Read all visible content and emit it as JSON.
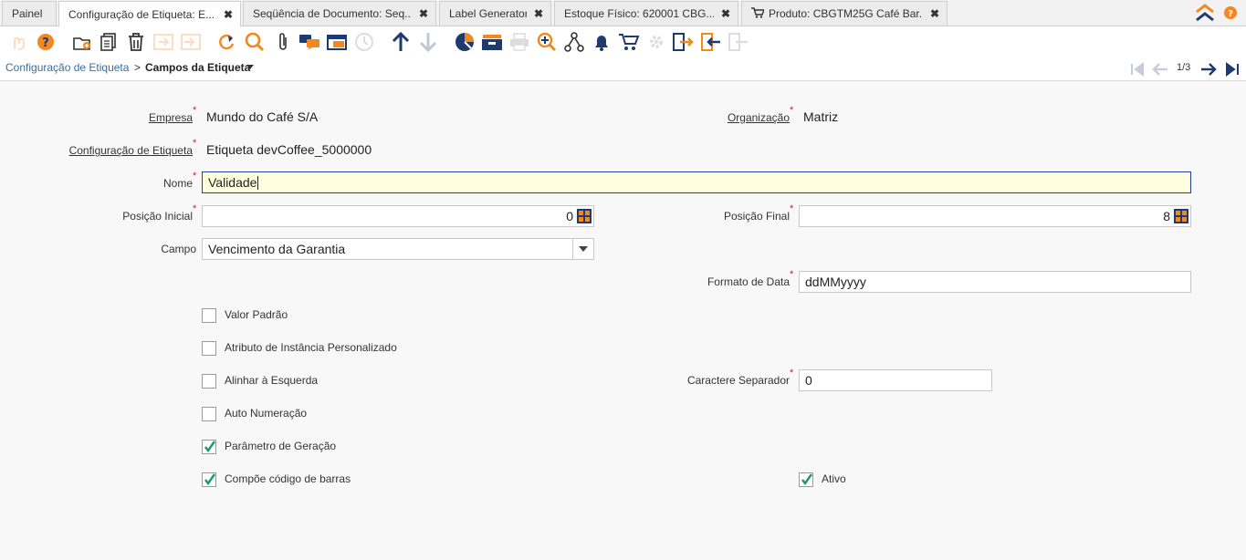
{
  "tabs": [
    {
      "label": "Painel",
      "closable": false,
      "active": false
    },
    {
      "label": "Configuração de Etiqueta: E...",
      "closable": true,
      "active": true
    },
    {
      "label": "Seqüência de Documento: Seq...",
      "closable": true,
      "active": false
    },
    {
      "label": "Label Generator",
      "closable": true,
      "active": false
    },
    {
      "label": "Estoque Físico: 620001 CBG...",
      "closable": true,
      "active": false
    },
    {
      "label": "Produto: CBGTM25G Café Bar...",
      "closable": true,
      "active": false,
      "icon": "cart-icon"
    }
  ],
  "close_glyph": "✖",
  "header_icons": [
    "collapse-up-icon",
    "help-icon"
  ],
  "toolbar_icons": [
    {
      "name": "undo-icon",
      "enabled": false
    },
    {
      "name": "help-icon",
      "enabled": true
    },
    {
      "name": "new-record-icon",
      "enabled": true
    },
    {
      "name": "copy-record-icon",
      "enabled": true
    },
    {
      "name": "delete-icon",
      "enabled": true
    },
    {
      "name": "save-icon",
      "enabled": false
    },
    {
      "name": "save-create-icon",
      "enabled": false
    },
    {
      "name": "refresh-icon",
      "enabled": true
    },
    {
      "name": "search-icon",
      "enabled": true
    },
    {
      "name": "attachment-icon",
      "enabled": true
    },
    {
      "name": "chat-icon",
      "enabled": true
    },
    {
      "name": "grid-toggle-icon",
      "enabled": true
    },
    {
      "name": "history-icon",
      "enabled": false
    },
    {
      "name": "parent-record-icon",
      "enabled": true
    },
    {
      "name": "detail-record-icon",
      "enabled": false
    },
    {
      "name": "report-icon",
      "enabled": true
    },
    {
      "name": "archive-icon",
      "enabled": true
    },
    {
      "name": "print-icon",
      "enabled": false
    },
    {
      "name": "zoom-across-icon",
      "enabled": true
    },
    {
      "name": "workflow-icon",
      "enabled": true
    },
    {
      "name": "notification-icon",
      "enabled": true
    },
    {
      "name": "product-info-icon",
      "enabled": true
    },
    {
      "name": "process-icon",
      "enabled": false
    },
    {
      "name": "export-icon",
      "enabled": true
    },
    {
      "name": "import-icon",
      "enabled": true
    },
    {
      "name": "quick-form-icon",
      "enabled": false
    }
  ],
  "breadcrumb": {
    "parent": "Configuração de Etiqueta",
    "separator": ">",
    "current": "Campos da Etiqueta"
  },
  "navigation": {
    "record_indicator": "1/3"
  },
  "form": {
    "empresa": {
      "label": "Empresa",
      "value": "Mundo do Café S/A"
    },
    "organizacao": {
      "label": "Organização",
      "value": "Matriz"
    },
    "configuracao": {
      "label": "Configuração de Etiqueta",
      "value": "Etiqueta devCoffee_5000000"
    },
    "nome": {
      "label": "Nome",
      "value": "Validade"
    },
    "posicao_inicial": {
      "label": "Posição Inicial",
      "value": "0"
    },
    "posicao_final": {
      "label": "Posição Final",
      "value": "8"
    },
    "campo": {
      "label": "Campo",
      "value": "Vencimento da Garantia"
    },
    "formato_data": {
      "label": "Formato de Data",
      "value": "ddMMyyyy"
    },
    "valor_padrao": {
      "label": "Valor Padrão",
      "checked": false
    },
    "atributo_instancia": {
      "label": "Atributo de Instância Personalizado",
      "checked": false
    },
    "alinhar_esquerda": {
      "label": "Alinhar à Esquerda",
      "checked": false
    },
    "caractere_separador": {
      "label": "Caractere Separador",
      "value": "0"
    },
    "auto_numeracao": {
      "label": "Auto Numeração",
      "checked": false
    },
    "parametro_geracao": {
      "label": "Parâmetro de Geração",
      "checked": true
    },
    "compoe_codigo": {
      "label": "Compõe código de barras",
      "checked": true
    },
    "ativo": {
      "label": "Ativo",
      "checked": true
    },
    "required_mark": "*"
  },
  "colors": {
    "accent": "#f5871f",
    "link": "#3a6e9c",
    "required": "#d02020",
    "highlight_bg": "#ffffdd",
    "check": "#1a9b5c"
  }
}
